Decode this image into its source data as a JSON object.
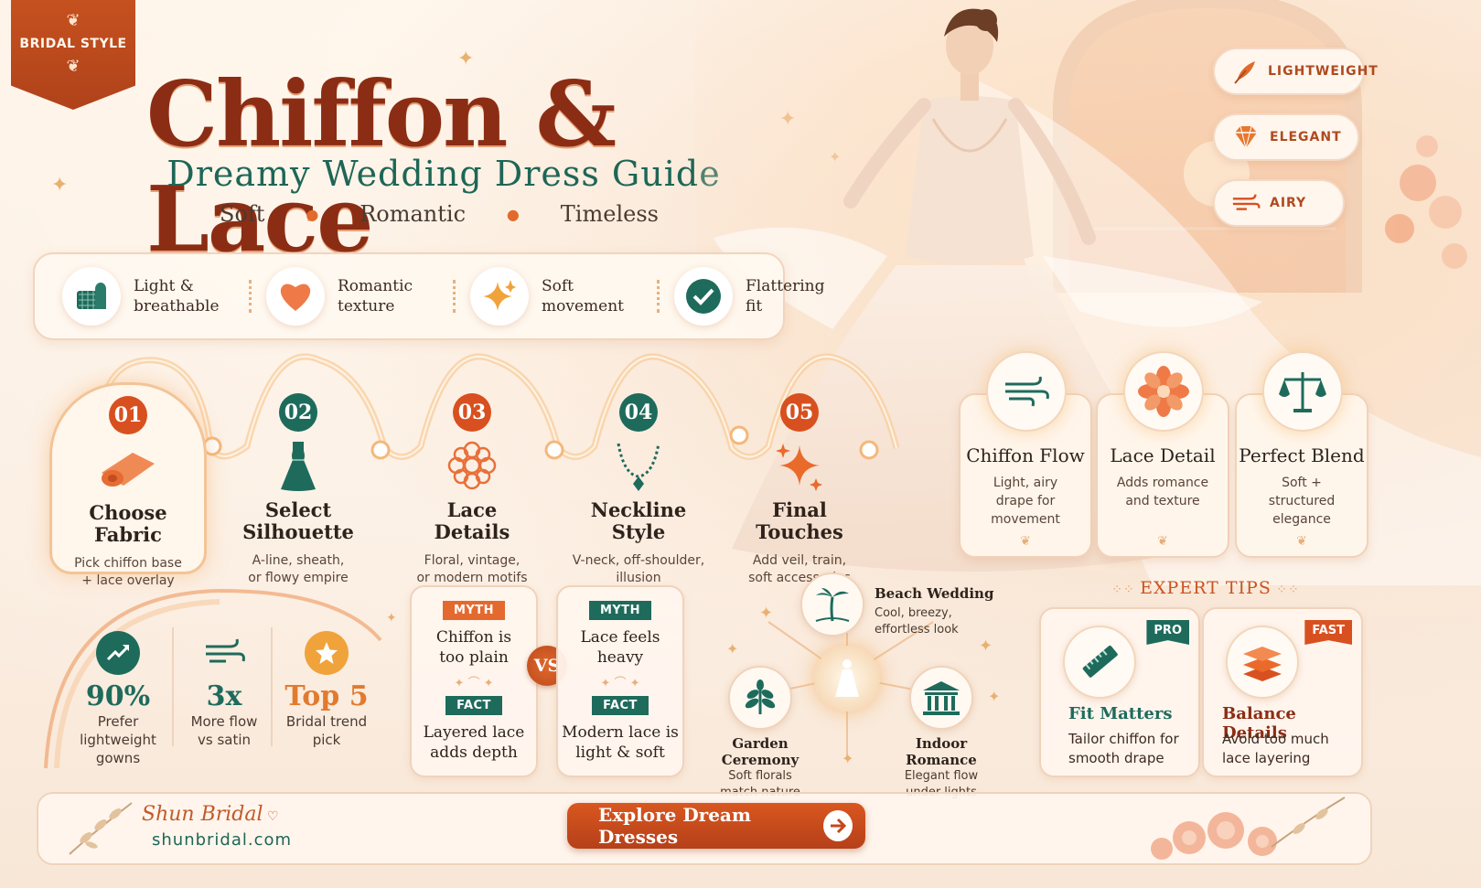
{
  "ribbon": {
    "label": "BRIDAL STYLE"
  },
  "header": {
    "title": "Chiffon & Lace",
    "subtitle": "Dreamy Wedding Dress Guide",
    "tagline": [
      "Soft",
      "Romantic",
      "Timeless"
    ]
  },
  "attributes": [
    {
      "label": "LIGHTWEIGHT",
      "icon": "feather-icon"
    },
    {
      "label": "ELEGANT",
      "icon": "diamond-icon"
    },
    {
      "label": "AIRY",
      "icon": "wind-icon"
    }
  ],
  "benefits": [
    {
      "label": "Light &\nbreathable",
      "icon": "fabric-roll-icon"
    },
    {
      "label": "Romantic\ntexture",
      "icon": "heart-icon"
    },
    {
      "label": "Soft\nmovement",
      "icon": "sparkle-icon"
    },
    {
      "label": "Flattering\nfit",
      "icon": "check-icon"
    }
  ],
  "steps": [
    {
      "num": "01",
      "title": "Choose\nFabric",
      "desc": "Pick chiffon base\n+ lace overlay",
      "color": "#d8501f",
      "icon": "fabric-roll-icon"
    },
    {
      "num": "02",
      "title": "Select\nSilhouette",
      "desc": "A-line, sheath,\nor flowy empire",
      "color": "#1e6b5c",
      "icon": "dress-icon"
    },
    {
      "num": "03",
      "title": "Lace\nDetails",
      "desc": "Floral, vintage,\nor modern motifs",
      "color": "#d8501f",
      "icon": "lace-flower-icon"
    },
    {
      "num": "04",
      "title": "Neckline\nStyle",
      "desc": "V-neck, off-shoulder,\nillusion",
      "color": "#1e6b5c",
      "icon": "necklace-icon"
    },
    {
      "num": "05",
      "title": "Final\nTouches",
      "desc": "Add veil, train,\nsoft accessories",
      "color": "#d8501f",
      "icon": "sparkle-icon"
    }
  ],
  "features": [
    {
      "title": "Chiffon Flow",
      "desc": "Light, airy\ndrape for\nmovement",
      "icon": "wind-icon"
    },
    {
      "title": "Lace Detail",
      "desc": "Adds romance\nand texture",
      "icon": "flower-icon"
    },
    {
      "title": "Perfect Blend",
      "desc": "Soft +\nstructured\nelegance",
      "icon": "scale-icon"
    }
  ],
  "stats": [
    {
      "value": "90%",
      "desc": "Prefer\nlightweight\ngowns",
      "icon": "trend-up-icon",
      "color": "#1e6b5c"
    },
    {
      "value": "3x",
      "desc": "More flow\nvs satin",
      "icon": "wind-icon",
      "color": "#1e6b5c"
    },
    {
      "value": "Top 5",
      "desc": "Bridal trend\npick",
      "icon": "star-icon",
      "color": "#e27a2e"
    }
  ],
  "myths": [
    {
      "myth_tag": "MYTH",
      "myth": "Chiffon is\ntoo plain",
      "fact_tag": "FACT",
      "fact": "Layered lace\nadds depth"
    },
    {
      "myth_tag": "MYTH",
      "myth": "Lace feels\nheavy",
      "fact_tag": "FACT",
      "fact": "Modern lace is\nlight & soft"
    }
  ],
  "vs_label": "VS",
  "venues": [
    {
      "title": "Beach Wedding",
      "desc": "Cool, breezy,\neffortless look",
      "icon": "palm-tree-icon"
    },
    {
      "title": "Garden Ceremony",
      "desc": "Soft florals\nmatch nature",
      "icon": "plant-icon"
    },
    {
      "title": "Indoor Romance",
      "desc": "Elegant flow\nunder lights",
      "icon": "building-icon"
    }
  ],
  "expert_tips": {
    "heading": "EXPERT TIPS",
    "tips": [
      {
        "badge": "PRO",
        "title": "Fit Matters",
        "desc": "Tailor chiffon for\nsmooth drape",
        "icon": "ruler-icon",
        "badge_color": "#1e6b5c",
        "title_color": "#1e6b5c"
      },
      {
        "badge": "FAST",
        "title": "Balance Details",
        "desc": "Avoid too much\nlace layering",
        "icon": "layers-icon",
        "badge_color": "#d8501f",
        "title_color": "#8b2d14"
      }
    ]
  },
  "footer": {
    "brand": "Shun Bridal",
    "domain": "shunbridal.com",
    "cta": "Explore Dream Dresses"
  },
  "colors": {
    "accent": "#d8501f",
    "teal": "#1e6b5c",
    "title": "#8b2d14"
  }
}
